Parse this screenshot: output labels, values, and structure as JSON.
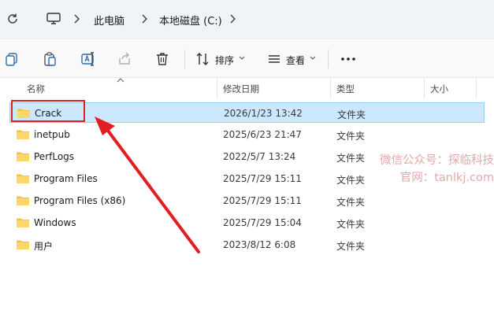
{
  "address": {
    "crumbs": [
      "此电脑",
      "本地磁盘 (C:)"
    ]
  },
  "toolbar": {
    "sort_label": "排序",
    "view_label": "查看"
  },
  "columns": {
    "name": "名称",
    "modified": "修改日期",
    "type": "类型",
    "size": "大小"
  },
  "files": [
    {
      "name": "Crack",
      "modified": "2026/1/23 13:42",
      "type": "文件夹"
    },
    {
      "name": "inetpub",
      "modified": "2025/6/23 21:47",
      "type": "文件夹"
    },
    {
      "name": "PerfLogs",
      "modified": "2022/5/7 13:24",
      "type": "文件夹"
    },
    {
      "name": "Program Files",
      "modified": "2025/7/29 15:11",
      "type": "文件夹"
    },
    {
      "name": "Program Files (x86)",
      "modified": "2025/7/29 15:11",
      "type": "文件夹"
    },
    {
      "name": "Windows",
      "modified": "2025/7/29 15:04",
      "type": "文件夹"
    },
    {
      "name": "用户",
      "modified": "2023/8/12 6:08",
      "type": "文件夹"
    }
  ],
  "watermark": {
    "line1": "微信公众号：探临科技",
    "line2": "官网：tanlkj.com"
  },
  "colors": {
    "selection": "#cce8ff",
    "annotation": "#e02020",
    "folder": "#f5c542"
  }
}
